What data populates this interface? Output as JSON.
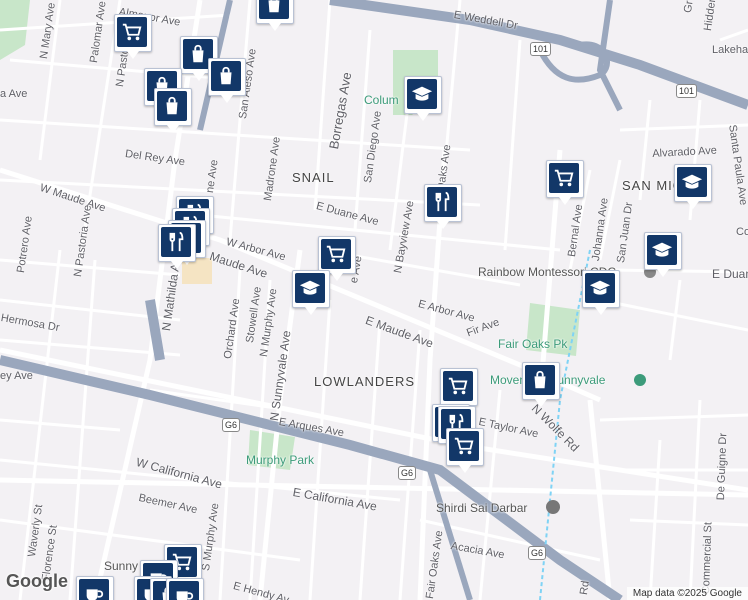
{
  "streets": [
    {
      "id": "almanor",
      "text": "Almanor Ave"
    },
    {
      "id": "weddell",
      "text": "E Weddell Dr"
    },
    {
      "id": "n-mary",
      "text": "N Mary Ave"
    },
    {
      "id": "palomar",
      "text": "Palomar Ave"
    },
    {
      "id": "n-pastoria-top",
      "text": "N Pastoria Ave"
    },
    {
      "id": "san-aleso",
      "text": "San Aleso Ave"
    },
    {
      "id": "borregas",
      "text": "Borregas Ave"
    },
    {
      "id": "san-diego",
      "text": "San Diego Ave"
    },
    {
      "id": "del-rey",
      "text": "Del Rey Ave"
    },
    {
      "id": "madrone",
      "text": "Madrone Ave"
    },
    {
      "id": "w-maude",
      "text": "W Maude Ave"
    },
    {
      "id": "e-duane",
      "text": "E Duane Ave"
    },
    {
      "id": "w-arbor",
      "text": "W Arbor Ave"
    },
    {
      "id": "n-bayview",
      "text": "N Bayview Ave"
    },
    {
      "id": "potrero",
      "text": "Potrero Ave"
    },
    {
      "id": "n-pastoria",
      "text": "N Pastoria Ave"
    },
    {
      "id": "n-mathilda",
      "text": "N Mathilda Ave"
    },
    {
      "id": "orchard",
      "text": "Orchard Ave"
    },
    {
      "id": "stowell",
      "text": "Stowell Ave"
    },
    {
      "id": "n-murphy",
      "text": "N Murphy Ave"
    },
    {
      "id": "n-sunnyvale",
      "text": "N Sunnyvale Ave"
    },
    {
      "id": "hermosa",
      "text": "Hermosa Dr"
    },
    {
      "id": "e-maude",
      "text": "E Maude Ave"
    },
    {
      "id": "e-arbor",
      "text": "E Arbor Ave"
    },
    {
      "id": "fir",
      "text": "Fir Ave"
    },
    {
      "id": "fair-oaks-top",
      "text": "Fair Oaks Ave"
    },
    {
      "id": "bernal",
      "text": "Bernal Ave"
    },
    {
      "id": "johanna",
      "text": "Johanna Ave"
    },
    {
      "id": "san-juan",
      "text": "San Juan Dr"
    },
    {
      "id": "alvarado",
      "text": "Alvarado Ave"
    },
    {
      "id": "santa-paula",
      "text": "Santa Paula Ave"
    },
    {
      "id": "hidden",
      "text": "Hidden"
    },
    {
      "id": "lakehaven",
      "text": "Lakehav"
    },
    {
      "id": "e-duane-right",
      "text": "E Duan"
    },
    {
      "id": "e-taylor",
      "text": "E Taylor Ave"
    },
    {
      "id": "e-arques",
      "text": "E Arques Ave"
    },
    {
      "id": "w-california",
      "text": "W California Ave"
    },
    {
      "id": "e-california",
      "text": "E California Ave"
    },
    {
      "id": "beemer",
      "text": "Beemer Ave"
    },
    {
      "id": "waverly",
      "text": "Waverly St"
    },
    {
      "id": "florence",
      "text": "Florence St"
    },
    {
      "id": "s-murphy",
      "text": "S Murphy Ave"
    },
    {
      "id": "e-hendy",
      "text": "E Hendy Av"
    },
    {
      "id": "acacia",
      "text": "Acacia Ave"
    },
    {
      "id": "fair-oaks-bottom",
      "text": "Fair Oaks Ave"
    },
    {
      "id": "wolfe",
      "text": "N Wolfe Rd"
    },
    {
      "id": "de-guigne",
      "text": "De Guigne Dr"
    },
    {
      "id": "commercial",
      "text": "Commercial St"
    },
    {
      "id": "rd-bottom",
      "text": "Rd"
    },
    {
      "id": "ey-ave",
      "text": "ey Ave"
    },
    {
      "id": "a-ave",
      "text": "a Ave"
    },
    {
      "id": "ne-ave",
      "text": "ne Ave"
    },
    {
      "id": "e-ave",
      "text": "e Ave"
    },
    {
      "id": "maude-frag",
      "text": "Maude Ave"
    },
    {
      "id": "co",
      "text": "Co"
    },
    {
      "id": "gr",
      "text": "Gr"
    }
  ],
  "areas": [
    {
      "id": "snail",
      "text": "SNAIL"
    },
    {
      "id": "lowlanders",
      "text": "LOWLANDERS"
    },
    {
      "id": "san-miguel",
      "text": "SAN MIGUEL"
    }
  ],
  "pois": [
    {
      "id": "columbia",
      "text": "Colum"
    },
    {
      "id": "rainbow",
      "text": "Rainbow Montessori CDC"
    },
    {
      "id": "fair-oaks-pk",
      "text": "Fair Oaks Pk"
    },
    {
      "id": "movement",
      "text": "Movement Sunnyvale"
    },
    {
      "id": "murphy-park",
      "text": "Murphy Park"
    },
    {
      "id": "shirdi",
      "text": "Shirdi Sai Darbar"
    },
    {
      "id": "sunny",
      "text": "Sunny"
    }
  ],
  "highways": [
    {
      "id": "us101-a",
      "text": "101"
    },
    {
      "id": "us101-b",
      "text": "101"
    },
    {
      "id": "g6-a",
      "text": "G6"
    },
    {
      "id": "g6-b",
      "text": "G6"
    },
    {
      "id": "g6-c",
      "text": "G6"
    }
  ],
  "markers": [
    {
      "id": "m1",
      "icon": "shopping-bag"
    },
    {
      "id": "m2",
      "icon": "shopping-cart"
    },
    {
      "id": "m3",
      "icon": "shopping-bag"
    },
    {
      "id": "m4",
      "icon": "shopping-bag"
    },
    {
      "id": "m5",
      "icon": "shopping-bag"
    },
    {
      "id": "m6",
      "icon": "shopping-bag"
    },
    {
      "id": "m7",
      "icon": "graduation-cap"
    },
    {
      "id": "m8",
      "icon": "restaurant"
    },
    {
      "id": "m9",
      "icon": "shopping-cart"
    },
    {
      "id": "m10",
      "icon": "graduation-cap"
    },
    {
      "id": "m11",
      "icon": "graduation-cap"
    },
    {
      "id": "m12",
      "icon": "graduation-cap"
    },
    {
      "id": "m13",
      "icon": "restaurant"
    },
    {
      "id": "m14",
      "icon": "restaurant"
    },
    {
      "id": "m15",
      "icon": "restaurant"
    },
    {
      "id": "m16",
      "icon": "restaurant"
    },
    {
      "id": "m17",
      "icon": "shopping-cart"
    },
    {
      "id": "m18",
      "icon": "graduation-cap"
    },
    {
      "id": "m19",
      "icon": "shopping-cart"
    },
    {
      "id": "m20",
      "icon": "shopping-bag"
    },
    {
      "id": "m21",
      "icon": "restaurant"
    },
    {
      "id": "m22",
      "icon": "restaurant"
    },
    {
      "id": "m23",
      "icon": "shopping-cart"
    },
    {
      "id": "m24",
      "icon": "coffee"
    },
    {
      "id": "m25",
      "icon": "shopping-cart"
    },
    {
      "id": "m26",
      "icon": "coffee"
    },
    {
      "id": "m27",
      "icon": "coffee"
    },
    {
      "id": "m28",
      "icon": "shopping-bag"
    },
    {
      "id": "m29",
      "icon": "coffee"
    }
  ],
  "attribution": {
    "logo": "Google",
    "copyright": "Map data ©2025 Google"
  },
  "colors": {
    "marker": "#123768",
    "park": "#c8e6c9",
    "highway": "#9aa7bd",
    "road": "#ffffff",
    "background": "#f3f1f4"
  }
}
